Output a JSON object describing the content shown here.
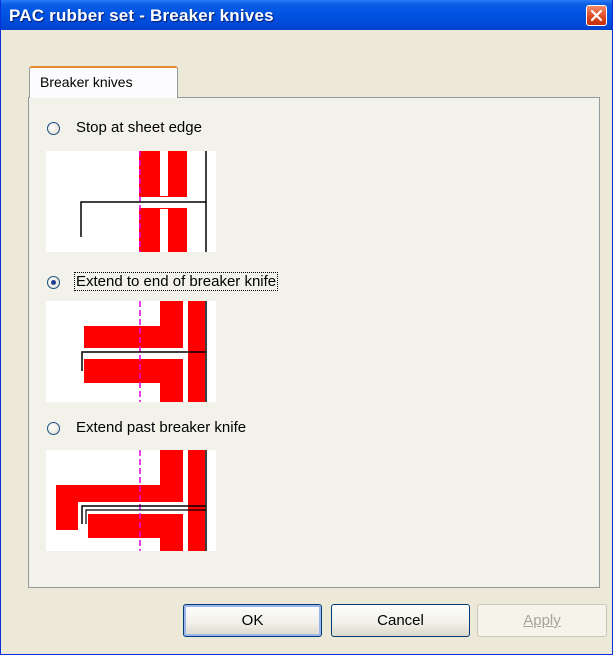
{
  "window": {
    "title": "PAC rubber set - Breaker knives"
  },
  "tabs": [
    {
      "label": "Breaker knives",
      "selected": true
    }
  ],
  "options": [
    {
      "label": "Stop at sheet edge",
      "selected": false
    },
    {
      "label": "Extend to end of breaker knife",
      "selected": true
    },
    {
      "label": "Extend past breaker knife",
      "selected": false
    }
  ],
  "buttons": {
    "ok": "OK",
    "cancel": "Cancel",
    "apply": "Apply",
    "apply_enabled": false
  },
  "colors": {
    "titlebar": "#0054e3",
    "knife_red": "#ff0000",
    "guide_magenta": "#e000e0",
    "dialog_bg": "#ece9d8"
  }
}
